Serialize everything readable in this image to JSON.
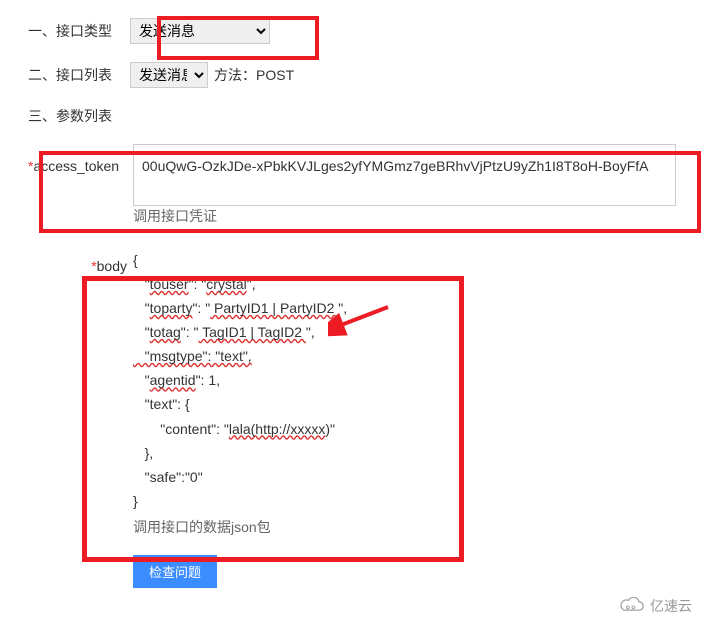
{
  "section1": {
    "label": "一、接口类型",
    "select_value": "发送消息"
  },
  "section2": {
    "label": "二、接口列表",
    "select_value": "发送消息",
    "method_label": "方法：POST"
  },
  "section3": {
    "label": "三、参数列表"
  },
  "params": {
    "access_token": {
      "name": "access_token",
      "value": "00uQwG-OzkJDe-xPbkKVJLges2yfYMGmz7geBRhvVjPtzU9yZh1I8T8oH-BoyFfA",
      "help": "调用接口凭证"
    },
    "body": {
      "name": "body",
      "json_open": "{",
      "line_touser_key": "touser",
      "line_touser_val": "crystal",
      "line_toparty_key": "toparty",
      "line_toparty_val": " PartyID1 | PartyID2 ",
      "line_totag_key": "totag",
      "line_totag_val": " TagID1 | TagID2 ",
      "line_msgtype": "   \"msgtype\": \"text\",",
      "line_agentid_key": "agentid",
      "line_text_open": "   \"text\": {",
      "line_content_label": "       \"content\": \"",
      "line_content_val": "lala(http://xxxxx",
      "line_content_close": ")\"",
      "line_text_close": "   },",
      "line_safe": "   \"safe\":\"0\"",
      "json_close": "}",
      "help": "调用接口的数据json包"
    }
  },
  "button": {
    "check": "检查问题"
  },
  "watermark": "亿速云"
}
